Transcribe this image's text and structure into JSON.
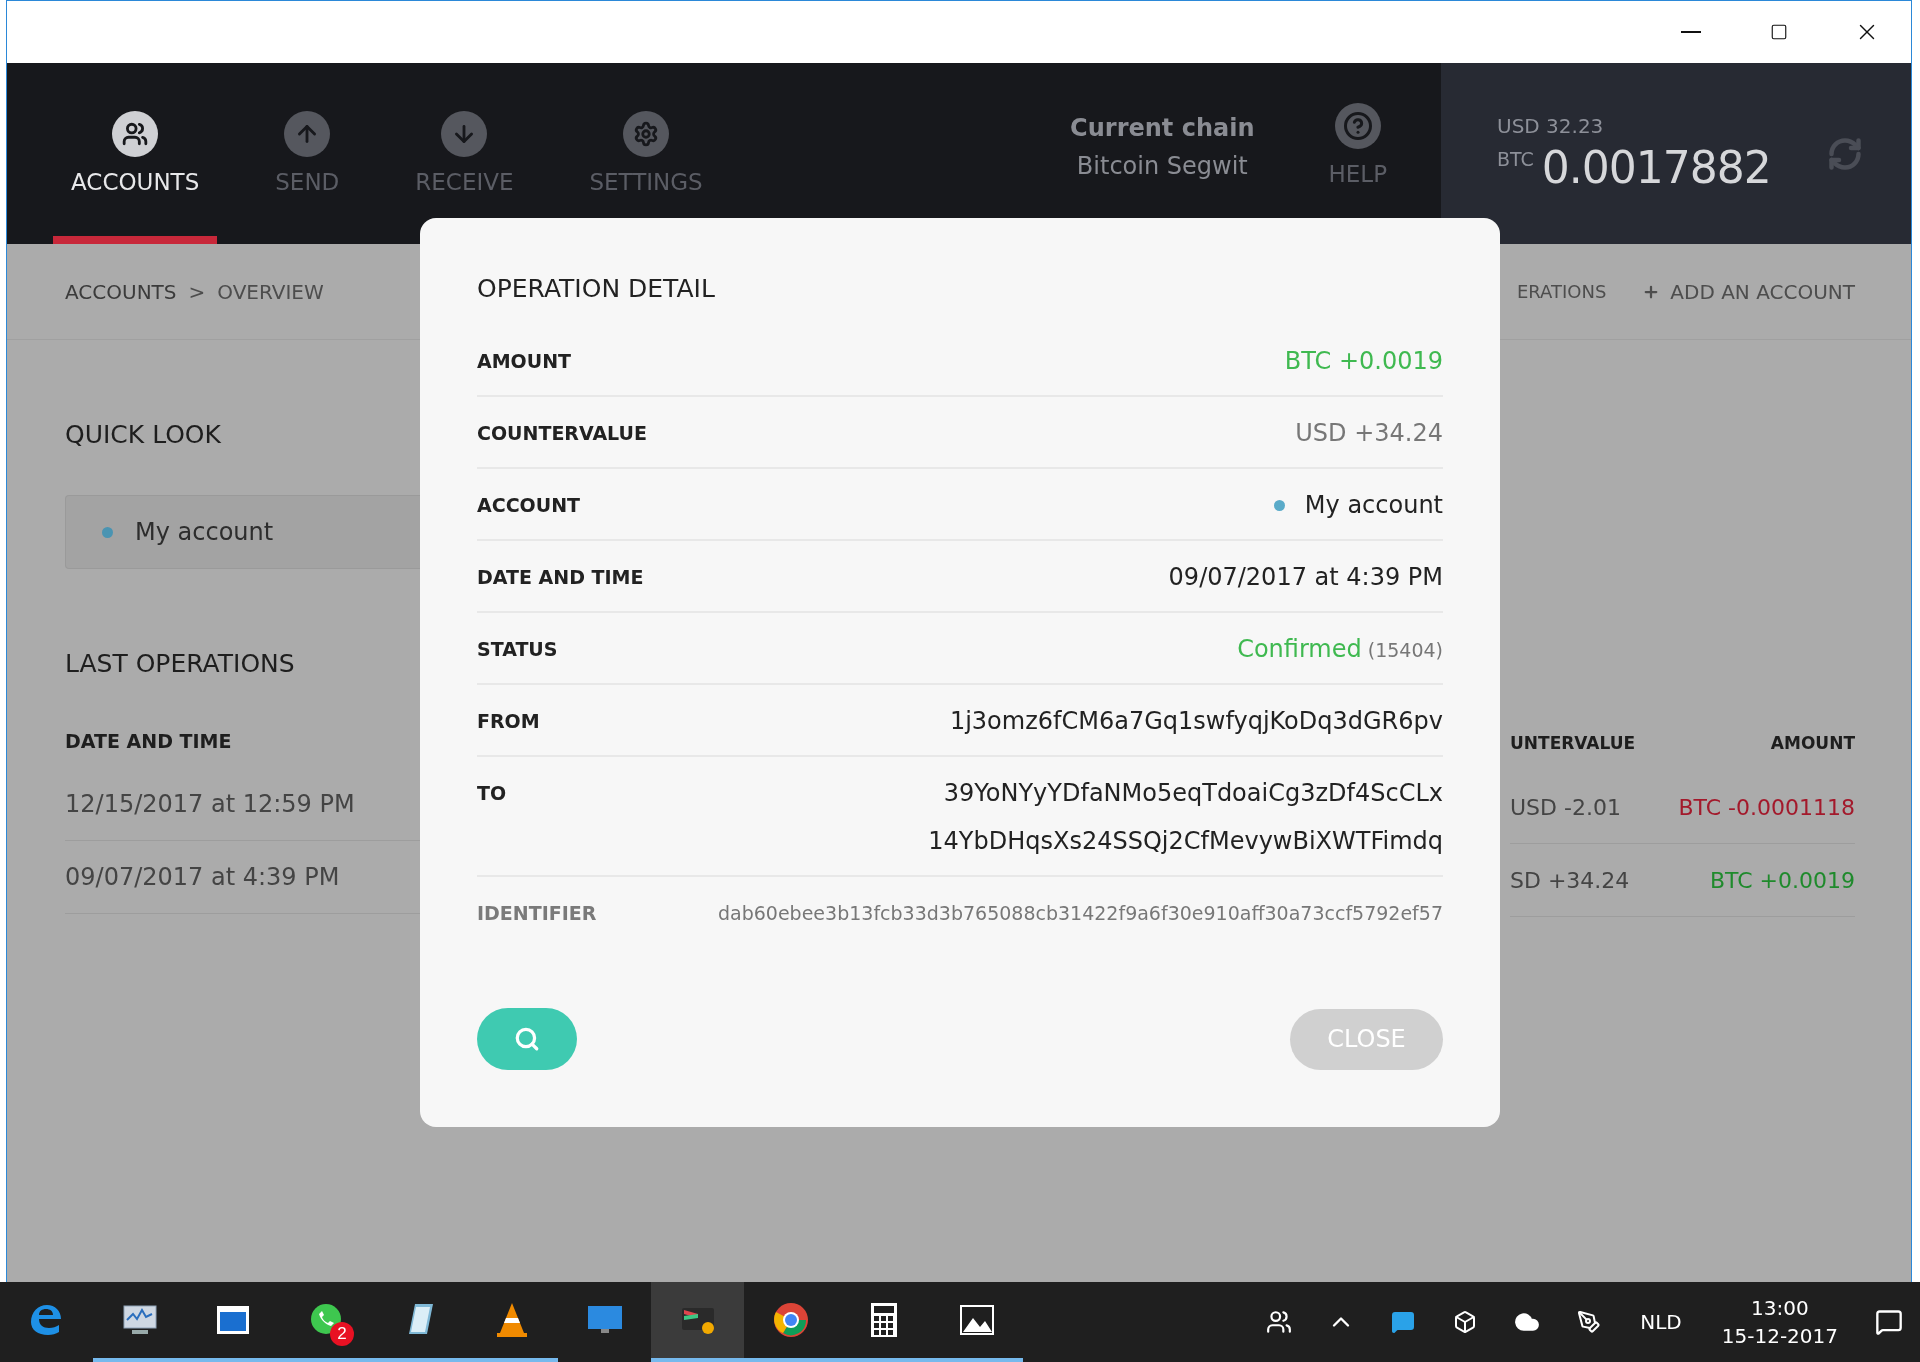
{
  "nav": {
    "tabs": [
      {
        "kind": "accounts",
        "label": "ACCOUNTS",
        "selected": true
      },
      {
        "kind": "send",
        "label": "SEND",
        "selected": false
      },
      {
        "kind": "receive",
        "label": "RECEIVE",
        "selected": false
      },
      {
        "kind": "settings",
        "label": "SETTINGS",
        "selected": false
      }
    ],
    "chain": {
      "title": "Current chain",
      "value": "Bitcoin Segwit"
    },
    "help": {
      "label": "HELP"
    },
    "balance": {
      "fiat": "USD 32.23",
      "unit": "BTC",
      "value": "0.0017882"
    }
  },
  "breadcrumb": {
    "items": [
      "ACCOUNTS",
      "OVERVIEW"
    ],
    "separator": ">"
  },
  "actions": {
    "cut_link": "ERATIONS",
    "add_account": "ADD AN ACCOUNT"
  },
  "quick_look": {
    "title": "QUICK LOOK",
    "accounts": [
      {
        "name": "My account",
        "color": "#4a94b2"
      }
    ]
  },
  "last_operations": {
    "title": "LAST OPERATIONS",
    "columns": {
      "left": "DATE AND TIME",
      "middle": "UNTERVALUE",
      "right": "AMOUNT"
    },
    "rows": [
      {
        "date": "12/15/2017 at 12:59 PM",
        "countervalue": "USD -2.01",
        "amount": "BTC -0.0001118",
        "kind": "debit"
      },
      {
        "date": "09/07/2017 at 4:39 PM",
        "countervalue": "SD +34.24",
        "amount": "BTC +0.0019",
        "kind": "credit"
      }
    ]
  },
  "modal": {
    "title": "OPERATION DETAIL",
    "rows": [
      {
        "kind": "amount",
        "label": "AMOUNT",
        "value": "BTC +0.0019"
      },
      {
        "kind": "plain",
        "label": "COUNTERVALUE",
        "value": "USD +34.24"
      },
      {
        "kind": "account",
        "label": "ACCOUNT",
        "value": "My account",
        "color": "#5aabc9"
      },
      {
        "kind": "dark",
        "label": "DATE AND TIME",
        "value": "09/07/2017 at 4:39 PM"
      },
      {
        "kind": "status",
        "label": "STATUS",
        "value": "Confirmed",
        "note": "(15404)"
      },
      {
        "kind": "dark",
        "label": "FROM",
        "value": "1j3omz6fCM6a7Gq1swfyqjKoDq3dGR6pv"
      },
      {
        "kind": "multi",
        "label": "TO",
        "values": [
          "39YoNYyYDfaNMo5eqTdoaiCg3zDf4ScCLx",
          "14YbDHqsXs24SSQj2CfMevywBiXWTFimdq"
        ]
      },
      {
        "kind": "muted",
        "label": "IDENTIFIER",
        "value": "dab60ebee3b13fcb33d3b765088cb31422f9a6f30e910aff30a73ccf5792ef57"
      }
    ],
    "close": "CLOSE"
  },
  "taskbar": {
    "apps": [
      {
        "kind": "edge",
        "running": false,
        "active": false
      },
      {
        "kind": "monitor",
        "running": true,
        "active": false
      },
      {
        "kind": "window",
        "running": true,
        "active": false
      },
      {
        "kind": "chat",
        "running": true,
        "active": false,
        "badge": "2"
      },
      {
        "kind": "notepad",
        "running": true,
        "active": false
      },
      {
        "kind": "cone",
        "running": true,
        "active": false
      },
      {
        "kind": "display",
        "running": false,
        "active": false
      },
      {
        "kind": "wallet",
        "running": true,
        "active": true
      },
      {
        "kind": "browser",
        "running": true,
        "active": false
      },
      {
        "kind": "calculator",
        "running": true,
        "active": false
      },
      {
        "kind": "photo",
        "running": true,
        "active": false
      }
    ],
    "language": "NLD",
    "time": "13:00",
    "date": "15-12-2017"
  }
}
